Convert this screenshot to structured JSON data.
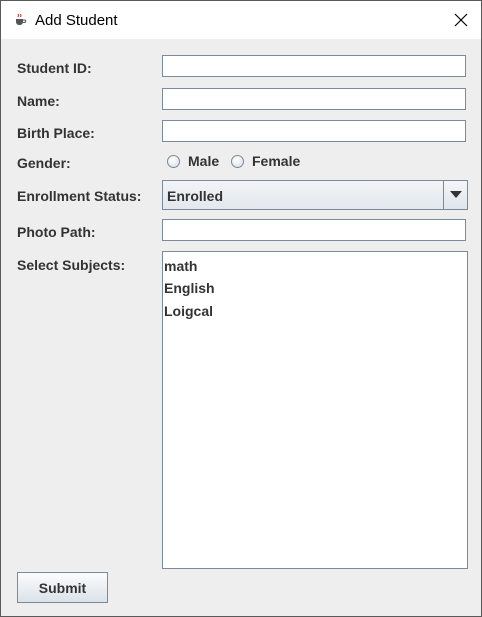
{
  "window": {
    "title": "Add Student"
  },
  "form": {
    "student_id_label": "Student ID:",
    "student_id_value": "",
    "name_label": "Name:",
    "name_value": "",
    "birth_place_label": "Birth Place:",
    "birth_place_value": "",
    "gender_label": "Gender:",
    "gender_options": [
      "Male",
      "Female"
    ],
    "enrollment_label": "Enrollment Status:",
    "enrollment_selected": "Enrolled",
    "photo_path_label": "Photo Path:",
    "photo_path_value": "",
    "subjects_label": "Select Subjects:",
    "subjects": [
      "math",
      "English",
      "Loigcal"
    ],
    "submit_label": "Submit"
  },
  "icons": {
    "app": "java-cup-icon",
    "close": "close-icon",
    "dropdown": "triangle-down-icon"
  },
  "colors": {
    "window_bg": "#eeeeee",
    "field_border": "#7a8a99",
    "label_text": "#333333"
  }
}
